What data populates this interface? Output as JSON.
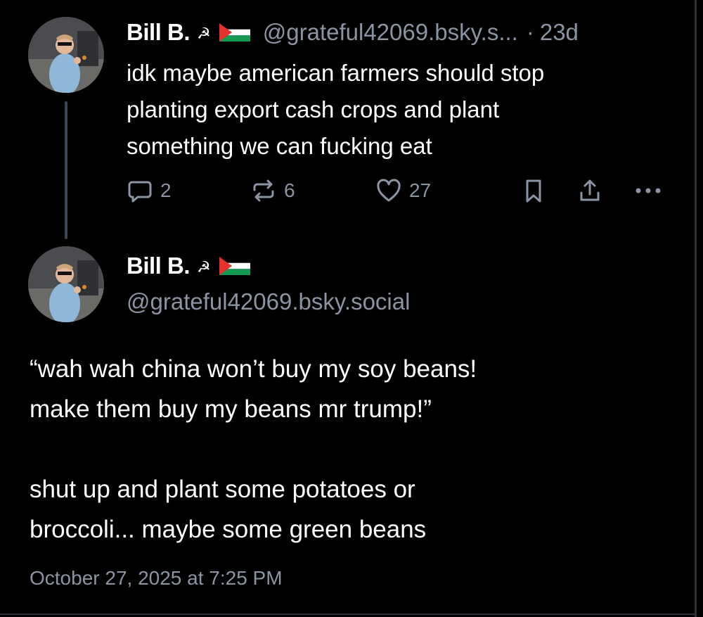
{
  "colors": {
    "background": "#000000",
    "primary_text": "#ffffff",
    "secondary_text": "#8b94a3",
    "thread_line": "#3d4552",
    "flag_black": "#000000",
    "flag_white": "#ffffff",
    "flag_green": "#149954",
    "flag_red": "#e4312b"
  },
  "parent_post": {
    "author_name": "Bill B.",
    "name_emoji": "☭",
    "flag_icon": "palestine-flag-icon",
    "handle": "@grateful42069.bsky.s...",
    "separator": "·",
    "age": "23d",
    "text": "idk maybe american farmers should stop\nplanting export cash crops and plant\nsomething we can fucking eat",
    "actions": {
      "reply_icon": "reply-bubble-icon",
      "reply_count": "2",
      "repost_icon": "repost-icon",
      "repost_count": "6",
      "like_icon": "heart-icon",
      "like_count": "27",
      "bookmark_icon": "bookmark-icon",
      "share_icon": "share-icon",
      "more_icon": "more-dots-icon"
    }
  },
  "main_post": {
    "author_name": "Bill B.",
    "name_emoji": "☭",
    "flag_icon": "palestine-flag-icon",
    "handle": "@grateful42069.bsky.social",
    "text": "“wah wah china won’t buy my soy beans!\nmake them buy my beans mr trump!”\n\nshut up and plant some potatoes or\nbroccoli... maybe some green beans",
    "timestamp": "October 27, 2025 at 7:25 PM"
  }
}
